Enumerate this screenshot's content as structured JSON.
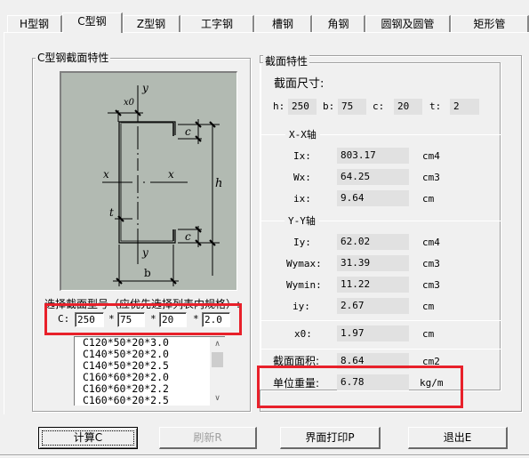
{
  "tabs": [
    {
      "label": "H型钢",
      "active": false
    },
    {
      "label": "C型钢",
      "active": true
    },
    {
      "label": "Z型钢",
      "active": false
    },
    {
      "label": "工字钢",
      "active": false
    },
    {
      "label": "槽钢",
      "active": false
    },
    {
      "label": "角钢",
      "active": false
    },
    {
      "label": "圆钢及圆管",
      "active": false
    },
    {
      "label": "矩形管",
      "active": false
    }
  ],
  "left_group": {
    "title": "C型钢截面特性",
    "diagram_labels": {
      "y_top": "y",
      "x0": "x0",
      "c_top": "c",
      "x_left": "x",
      "x_right": "x",
      "h": "h",
      "t": "t",
      "c_bottom": "c",
      "y_bottom": "y",
      "b": "b"
    },
    "select_label": "选择截面型号（应优先选择列表内规格）:",
    "spec_prefix": "C:",
    "spec_inputs": [
      "250",
      "75",
      "20",
      "2.0"
    ],
    "spec_sep": "*",
    "spec_list": [
      "C120*50*20*3.0",
      "C140*50*20*2.0",
      "C140*50*20*2.5",
      "C160*60*20*2.0",
      "C160*60*20*2.2",
      "C160*60*20*2.5"
    ]
  },
  "right_group": {
    "title": "截面特性",
    "dims_title": "截面尺寸:",
    "dims": [
      {
        "label": "h:",
        "value": "250"
      },
      {
        "label": "b:",
        "value": "75"
      },
      {
        "label": "c:",
        "value": "20"
      },
      {
        "label": "t:",
        "value": "2"
      }
    ],
    "xx_title": "X-X轴",
    "xx": [
      {
        "label": "Ix:",
        "value": "803.17",
        "unit": "cm4"
      },
      {
        "label": "Wx:",
        "value": "64.25",
        "unit": "cm3"
      },
      {
        "label": "ix:",
        "value": "9.64",
        "unit": "cm"
      }
    ],
    "yy_title": "Y-Y轴",
    "yy": [
      {
        "label": "Iy:",
        "value": "62.02",
        "unit": "cm4"
      },
      {
        "label": "Wymax:",
        "value": "31.39",
        "unit": "cm3"
      },
      {
        "label": "Wymin:",
        "value": "11.22",
        "unit": "cm3"
      },
      {
        "label": "iy:",
        "value": "2.67",
        "unit": "cm"
      }
    ],
    "x0": {
      "label": "x0:",
      "value": "1.97",
      "unit": "cm"
    },
    "area": {
      "label": "截面面积:",
      "value": "8.64",
      "unit": "cm2"
    },
    "weight": {
      "label": "单位重量:",
      "value": "6.78",
      "unit": "kg/m"
    }
  },
  "buttons": {
    "calc": "计算C",
    "refresh": "刷新R",
    "print": "界面打印P",
    "exit": "退出E"
  },
  "highlight_color": "#e8202a"
}
